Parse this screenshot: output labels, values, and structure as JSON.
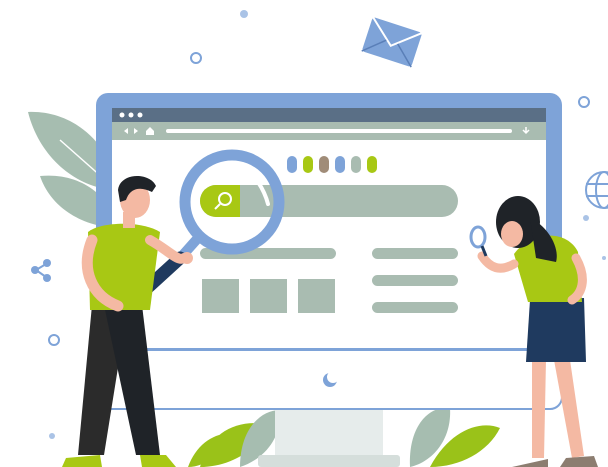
{
  "colors": {
    "frame_blue": "#7ea3d8",
    "screen_bg": "#ffffff",
    "browser_bar": "#5a6f86",
    "address_bar": "#a9bcb1",
    "placeholder_gray": "#a9bcb1",
    "accent_green": "#a8c814",
    "navy": "#1f3a5f",
    "skin": "#f4b9a3",
    "hair": "#1f2328",
    "leaf_gray": "#a6bdb0",
    "leaf_green": "#9ac219",
    "stand": "#e6eceb",
    "dot_blue": "#aac3e6"
  },
  "illustration": {
    "browser_dots_count": 3,
    "swatch_colors": [
      "#7ea3d8",
      "#a8c814",
      "#a08c78",
      "#7ea3d8",
      "#a9bcb1",
      "#a8c814"
    ],
    "search_icon": "search-icon",
    "envelope_icon": "envelope-icon",
    "globe_icon": "globe-icon",
    "share_icon": "share-icon",
    "moon_icon": "moon-icon",
    "image_tiles_count": 3,
    "list_lines_count": 3
  }
}
